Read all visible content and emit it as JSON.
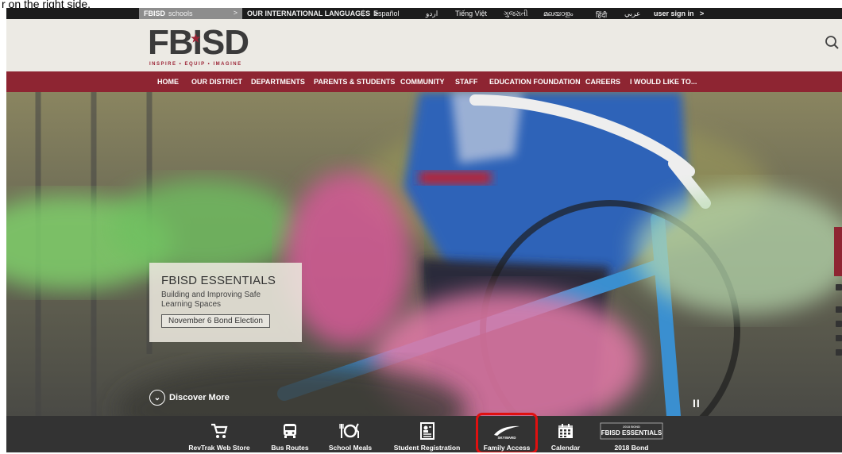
{
  "caption": "r on the right side.",
  "topbar": {
    "brand": "FBISD",
    "schools": "schools",
    "schools_chevron": ">",
    "languages_label": "OUR INTERNATIONAL LANGUAGES",
    "languages_chevron": ">",
    "separator": "|",
    "languages": [
      "Español",
      "اردو",
      "Tiếng Việt",
      "ગુજરાતી",
      "മലയാളം",
      "हिंदी",
      "عربي"
    ],
    "signin": "user sign in",
    "signin_chevron": ">"
  },
  "header": {
    "logo": "FBISD",
    "tagline": "INSPIRE • EQUIP • IMAGINE"
  },
  "nav": {
    "items": [
      "HOME",
      "OUR DISTRICT",
      "DEPARTMENTS",
      "PARENTS & STUDENTS",
      "COMMUNITY",
      "STAFF",
      "EDUCATION FOUNDATION",
      "CAREERS",
      "I WOULD LIKE TO..."
    ]
  },
  "hero": {
    "promo_title": "FBISD ESSENTIALS",
    "promo_subtitle": "Building and Improving Safe Learning Spaces",
    "promo_button": "November 6 Bond Election",
    "discover": "Discover More",
    "pause_symbol": "II"
  },
  "quicklinks": {
    "items": [
      {
        "label": "RevTrak Web Store",
        "icon": "cart-icon"
      },
      {
        "label": "Bus Routes",
        "icon": "bus-icon"
      },
      {
        "label": "School Meals",
        "icon": "meal-icon"
      },
      {
        "label": "Student Registration",
        "icon": "registration-icon"
      },
      {
        "label": "Family Access",
        "icon": "skyward-icon"
      },
      {
        "label": "Calendar",
        "icon": "calendar-icon"
      },
      {
        "label": "2018 Bond",
        "icon": "bond-logo-icon"
      }
    ],
    "skyward_text": "SKYWARD",
    "bond_logo_top": "2018 BOND",
    "bond_logo_text": "FBISD ESSENTIALS"
  },
  "colors": {
    "brand_red": "#8e2532",
    "highlight": "#e01010",
    "quickbar": "#333333"
  }
}
